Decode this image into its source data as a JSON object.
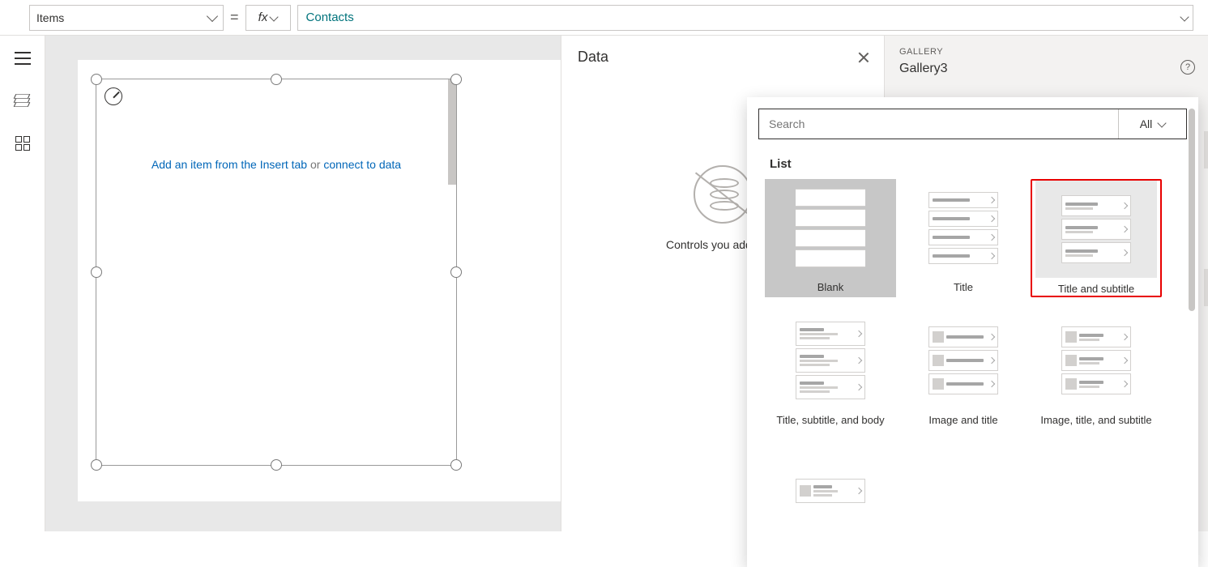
{
  "formula": {
    "property": "Items",
    "equals": "=",
    "fx": "fx",
    "value": "Contacts"
  },
  "canvas": {
    "hint_pre": "Add an item from the Insert tab ",
    "hint_or": "or ",
    "hint_link": "connect to data"
  },
  "dataPane": {
    "title": "Data",
    "empty": "Controls you add will s"
  },
  "propPane": {
    "category": "GALLERY",
    "name": "Gallery3"
  },
  "flyout": {
    "search_placeholder": "Search",
    "filter": "All",
    "section": "List",
    "tiles": {
      "blank": "Blank",
      "title": "Title",
      "title_sub": "Title and subtitle",
      "tsb": "Title, subtitle, and body",
      "img_title": "Image and title",
      "img_ts": "Image, title, and subtitle"
    }
  }
}
